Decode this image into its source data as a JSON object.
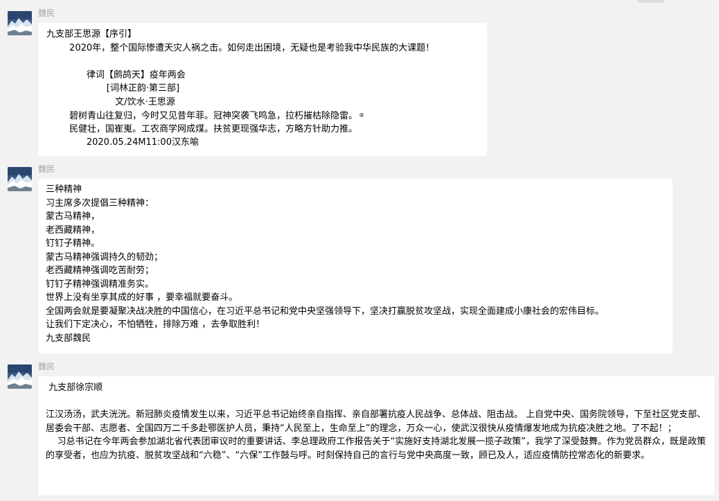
{
  "chat": {
    "messages": [
      {
        "sender": "魏民",
        "avatar_icon": "mountain-snow-avatar-icon",
        "lines": [
          "九支部王思源【序引】",
          "        2020年，整个国际惨遭天灾人祸之击。如何走出困境，无疑也是考验我中华民族的大课题！",
          "",
          "              律词【鹧鸪天】疫年两会",
          "                     [词林正韵·第三部]",
          "                        文/饮水·王思源",
          "        碧树青山往复归，今时又见昔年菲。冠神突袭飞鸣急，拉朽摧枯除隐雷。",
          "        民健壮，国崔嵬。工农商学网成煤。扶贫更现强华志，方略方针助力推。",
          "              2020.05.24M11:00汉东喻"
        ],
        "line2_mark": "®"
      },
      {
        "sender": "魏民",
        "avatar_icon": "mountain-snow-avatar-icon",
        "lines": [
          "三种精神",
          "习主席多次提倡三种精神：",
          "蒙古马精神，",
          "老西藏精神，",
          "钉钉子精神。",
          "蒙古马精神强调持久的韧劲；",
          "老西藏精神强调吃苦耐劳；",
          "钉钉子精神强调精准务实。",
          "世界上没有坐享其成的好事 ，要幸福就要奋斗。",
          "全国两会就是要凝聚决战决胜的中国信心，在习近平总书记和党中央坚强领导下，坚决打赢脱贫攻坚战，实现全面建成小康社会的宏伟目标。",
          "让我们下定决心，不怕牺牲，排除万难 ，去争取胜利！",
          "九支部魏民"
        ]
      },
      {
        "sender": "魏民",
        "avatar_icon": "mountain-snow-avatar-icon",
        "title": " 九支部徐宗顺",
        "paragraphs": [
          "江汉汤汤，武夫洸洸。新冠肺炎疫情发生以来，习近平总书记始终亲自指挥、亲自部署抗疫人民战争、总体战、阻击战。 上自党中央、国务院领导，下至社区党支部、居委会干部、志愿者、全国四万二千多赴鄂医护人员，秉持“人民至上，生命至上”的理念，万众一心，使武汉很快从疫情爆发地成为抗疫决胜之地。了不起！；",
          "    习总书记在今年两会参加湖北省代表团审议时的重要讲话、李总理政府工作报告关于“实施好支持湖北发展一揽子政策”，我学了深受鼓舞。作为党员群众，既是政策的享受者，也应为抗疫、脱贫攻坚战和“六稳”、“六保”工作鼓与呼。时刻保持自己的言行与党中央高度一致，顾已及人，适应疫情防控常态化的新要求。"
        ]
      }
    ]
  }
}
